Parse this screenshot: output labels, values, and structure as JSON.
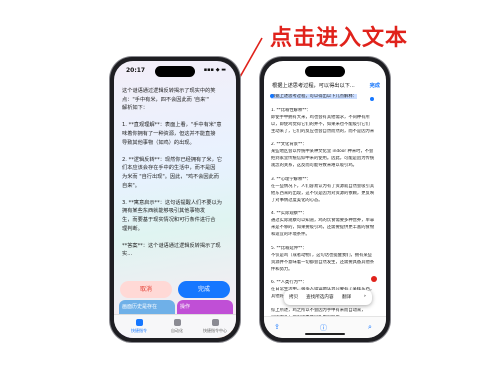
{
  "annotation": {
    "text": "点击进入文本",
    "color": "#e0221b"
  },
  "phone1": {
    "status": {
      "time": "20:17",
      "icons": "▪▪▪ ◆ ▬"
    },
    "text": [
      "这个谜语通过逻辑反转揭示了现实中的笑",
      "点：\"手中有米，四不会因此而 '自来'\"",
      "解析如下：",
      "",
      "1. **直观理解**：表面上看，\"手中有米\"意",
      "味着你拥有了一种资源，但这并不能直接",
      "导致其他事物（如鸡）的出现。",
      "",
      "2. **逻辑反转**：现然你已经拥有了米，它",
      "们本应该会存在手中的生活中，而不是因",
      "为米而 \"自行出现\"。因此，\"鸡不会因此而",
      "自来\"。",
      "",
      "3. **寓意启示**：这句话提醒人们不要以为",
      "拥有某些东西就能够吸引其他事物发",
      "生，而要基于现实情况和可行条件进行合",
      "理判断。",
      "",
      "**答案**：这个谜语通过逻辑反转揭示了现实..."
    ],
    "buttons": {
      "cancel": "取消",
      "done": "完成"
    },
    "tiles": [
      {
        "label": "",
        "color": "#7b4fe0"
      },
      {
        "label": "",
        "color": "#4fae5a"
      },
      {
        "label": "画面历史是存在",
        "color": "#6fb0e8"
      },
      {
        "label": "操作",
        "color": "#c04fd6"
      },
      {
        "label": "操作指导 Ultra",
        "color": "#9a6af0"
      },
      {
        "label": "",
        "color": "#e8772e"
      }
    ],
    "tabs": [
      {
        "label": "快捷指令",
        "active": true
      },
      {
        "label": "自动化",
        "active": false
      },
      {
        "label": "快捷指令中心",
        "active": false
      }
    ]
  },
  "phone2": {
    "nav": {
      "title": "根据上述思考过程，可以得出以下...",
      "chevron": "⌄",
      "done": "完成"
    },
    "lines": [
      {
        "t": "根据上述思考过程，可以得出以下几点解释：",
        "sel": true
      },
      {
        "t": "",
        "sel": false
      },
      {
        "t": "1. **比喻性解释**：",
        "sel": false
      },
      {
        "t": "  即使手中拥有大米，鸡也会有其他需求，不同种有所",
        "sel": false
      },
      {
        "t": "  以，即使鸡觉得它们的并不，如果米也不能吸引它们",
        "sel": false
      },
      {
        "t": "  主动来了，它们的反应也会自然而然的，而不是因为米",
        "sel": false
      },
      {
        "t": "",
        "sel": false
      },
      {
        "t": "2. **文化背景**：",
        "sel": false
      },
      {
        "t": "  某些地区会以传统中某种文化里 indoor 种米时，不会",
        "sel": false
      },
      {
        "t": "  把到家里传统信仰中米的使用。因此，可能是因为传统",
        "sel": false
      },
      {
        "t": "  观念的关系，这反而可能导致米难以吸引鸡。",
        "sel": false
      },
      {
        "t": "",
        "sel": false
      },
      {
        "t": "3. **心理学解释**：",
        "sel": false
      },
      {
        "t": "  在一些情况下，人们容易认为有了资源就自然会吸引其",
        "sel": false
      },
      {
        "t": "  他东西来的出现，这不仅是因为对资源的依赖，更反映",
        "sel": false
      },
      {
        "t": "  了对事情过度美化的心态。",
        "sel": false
      },
      {
        "t": "",
        "sel": false
      },
      {
        "t": "4. **实际观察**：",
        "sel": false
      },
      {
        "t": "  通过实际观察可以知道，鸡的饮食需要多种营养，单靠",
        "sel": false
      },
      {
        "t": "  米是不够的，如果要吸引鸡，还需要提供更丰富的食物",
        "sel": false
      },
      {
        "t": "  和适宜的环境条件。",
        "sel": false
      },
      {
        "t": "",
        "sel": false
      },
      {
        "t": "5. **比喻延伸**：",
        "sel": false
      },
      {
        "t": "  不仅是鸡（或者动物），这句话也提醒我们，拥有某些",
        "sel": false
      },
      {
        "t": "  资源并不意味着一切都会自然发生，还需要具备其他条",
        "sel": false
      },
      {
        "t": "  件和努力。",
        "sel": false
      },
      {
        "t": "",
        "sel": false
      },
      {
        "t": "6. **人类行为**：",
        "sel": false
      },
      {
        "t": "  在日常生活中，很多人错误地认为只要有了某样东西，",
        "sel": false
      },
      {
        "t": "  其他好事就会接踵而至，这其实是一种误区。",
        "sel": false
      },
      {
        "t": "",
        "sel": false
      },
      {
        "t": "综上所述，鸡之所以不会因为手中有米而自动来，",
        "sel": false
      },
      {
        "t": "是因为多方面的因素共同作用的结果。",
        "sel": false
      }
    ],
    "context_menu": [
      "拷贝",
      "查找所选内容",
      "翻译",
      "›"
    ],
    "bottom": {
      "share": "⇪",
      "lookup": "ⓘ",
      "search": "⌕"
    }
  }
}
